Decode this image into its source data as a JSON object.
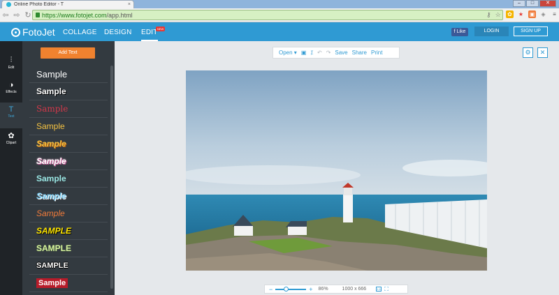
{
  "browser": {
    "tab_title": "Online Photo Editor - T",
    "tab_close": "×",
    "url_scheme": "https://",
    "url_host": "www.fotojet.com",
    "url_path": "/app.html"
  },
  "app": {
    "logo_text": "FotoJet",
    "nav": {
      "collage": "COLLAGE",
      "design": "DESIGN",
      "edit": "EDIT",
      "new_badge": "NEW"
    },
    "fb_like": "f Like",
    "login": "LOGIN",
    "signup": "SIGN UP"
  },
  "rail": {
    "items": [
      {
        "label": "Edit",
        "icon": "sliders-icon"
      },
      {
        "label": "Effects",
        "icon": "effects-icon"
      },
      {
        "label": "Text",
        "icon": "text-icon"
      },
      {
        "label": "Clipart",
        "icon": "clipart-icon"
      }
    ],
    "active": "Text"
  },
  "panel": {
    "add_text": "Add Text",
    "samples": [
      {
        "text": "Sample",
        "color": "#ffffff"
      },
      {
        "text": "Sample",
        "color": "#ffffff"
      },
      {
        "text": "Sample",
        "color": "#d2384a"
      },
      {
        "text": "Sample",
        "color": "#f4c242"
      },
      {
        "text": "Sample",
        "color": "#f4c242"
      },
      {
        "text": "Sample",
        "color": "#e8a2c8"
      },
      {
        "text": "Sample",
        "color": "#9ae7e4"
      },
      {
        "text": "Sample",
        "color": "#7fd0f5"
      },
      {
        "text": "Sample",
        "color": "#f07b3a"
      },
      {
        "text": "SAMPLE",
        "color": "#ffe600"
      },
      {
        "text": "SAMPLE",
        "color": "#d6f0a0"
      },
      {
        "text": "SAMPLE",
        "color": "#ffffff"
      },
      {
        "text": "Sample",
        "color": "#ffffff"
      }
    ]
  },
  "editor": {
    "toolbar": {
      "open": "Open ▾",
      "save": "Save",
      "share": "Share",
      "print": "Print"
    },
    "zoom_percent": "86%",
    "image_size": "1000 x 666",
    "zoom_fit": "1:1"
  },
  "colors": {
    "accent": "#2f9ad3",
    "header": "#2f9ad3",
    "add_text": "#f0822f"
  }
}
